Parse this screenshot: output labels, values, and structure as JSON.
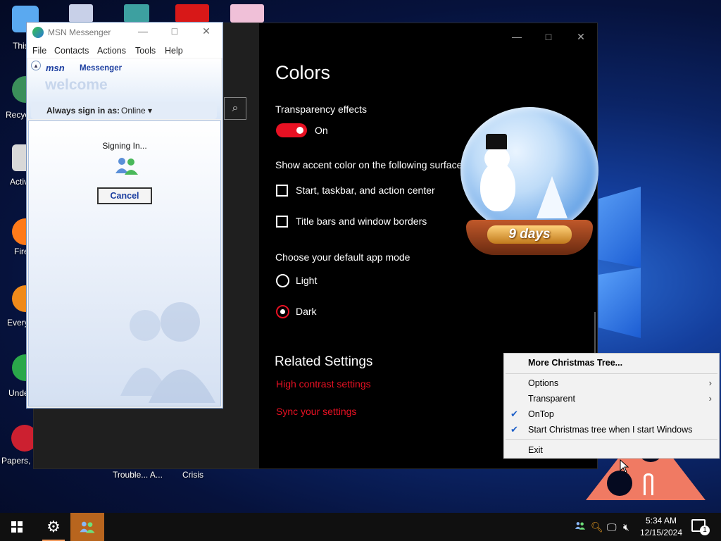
{
  "desktop": {
    "icons": [
      {
        "label": "This",
        "color": "#5aa9f0"
      },
      {
        "label": "Recyc",
        "color": "#3b8f5a"
      },
      {
        "label": "Activ",
        "color": "#d8d8d8"
      },
      {
        "label": "Fire",
        "color": "#ff7a1a"
      },
      {
        "label": "Every",
        "color": "#f08a1a"
      },
      {
        "label": "Unde",
        "color": "#2aa84a"
      },
      {
        "label": "Papers, P",
        "color": "#cc2030"
      }
    ],
    "bottom_labels": [
      "Trouble... A...",
      "Crisis"
    ]
  },
  "settings": {
    "title": "Colors",
    "transparency_label": "Transparency effects",
    "toggle_state": "On",
    "accent_label": "Show accent color on the following surface",
    "options": [
      "Start, taskbar, and action center",
      "Title bars and window borders"
    ],
    "app_mode_label": "Choose your default app mode",
    "modes": [
      "Light",
      "Dark"
    ],
    "selected_mode": "Dark",
    "related_title": "Related Settings",
    "links": [
      "High contrast settings",
      "Sync your settings"
    ],
    "accent_color": "#e81123"
  },
  "snow_globe": {
    "days_text": "9 days"
  },
  "msn": {
    "title": "MSN Messenger",
    "menu": [
      "File",
      "Contacts",
      "Actions",
      "Tools",
      "Help"
    ],
    "logo_msn": "msn",
    "logo_messenger": "Messenger",
    "welcome": "welcome",
    "signin_label": "Always sign in as:",
    "signin_value": "Online ▾",
    "status_text": "Signing In...",
    "cancel_label": "Cancel"
  },
  "context_menu": {
    "items": [
      {
        "label": "More Christmas Tree...",
        "bold": true
      },
      {
        "label": "Options",
        "submenu": true
      },
      {
        "label": "Transparent",
        "submenu": true
      },
      {
        "label": "OnTop",
        "checked": true
      },
      {
        "label": "Start Christmas tree when I start Windows",
        "checked": true
      },
      {
        "label": "Exit"
      }
    ]
  },
  "taskbar": {
    "time": "5:34 AM",
    "date": "12/15/2024",
    "notification_count": "1"
  }
}
